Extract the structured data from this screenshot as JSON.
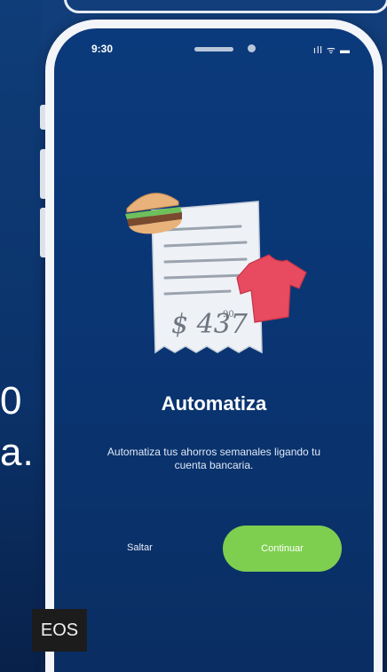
{
  "phone": {
    "status_time": "9:30",
    "status_icons": "ıll ᯤ ▬"
  },
  "illustration": {
    "amount_text": "$ 437",
    "amount_cents": "90",
    "icons": [
      "burger-icon",
      "receipt-icon",
      "tshirt-icon"
    ]
  },
  "screen": {
    "title": "Automatiza",
    "description": "Automatiza tus ahorros semanales ligando tu cuenta bancaria.",
    "skip_label": "Saltar",
    "continue_label": "Continuar"
  },
  "background": {
    "left_text_line1": "0",
    "left_text_line2": "a.",
    "badge_text": "EOS"
  },
  "colors": {
    "screen_bg": "#0b3a7c",
    "accent_green": "#7ecf4f",
    "receipt_tag": "#e84a5f"
  }
}
